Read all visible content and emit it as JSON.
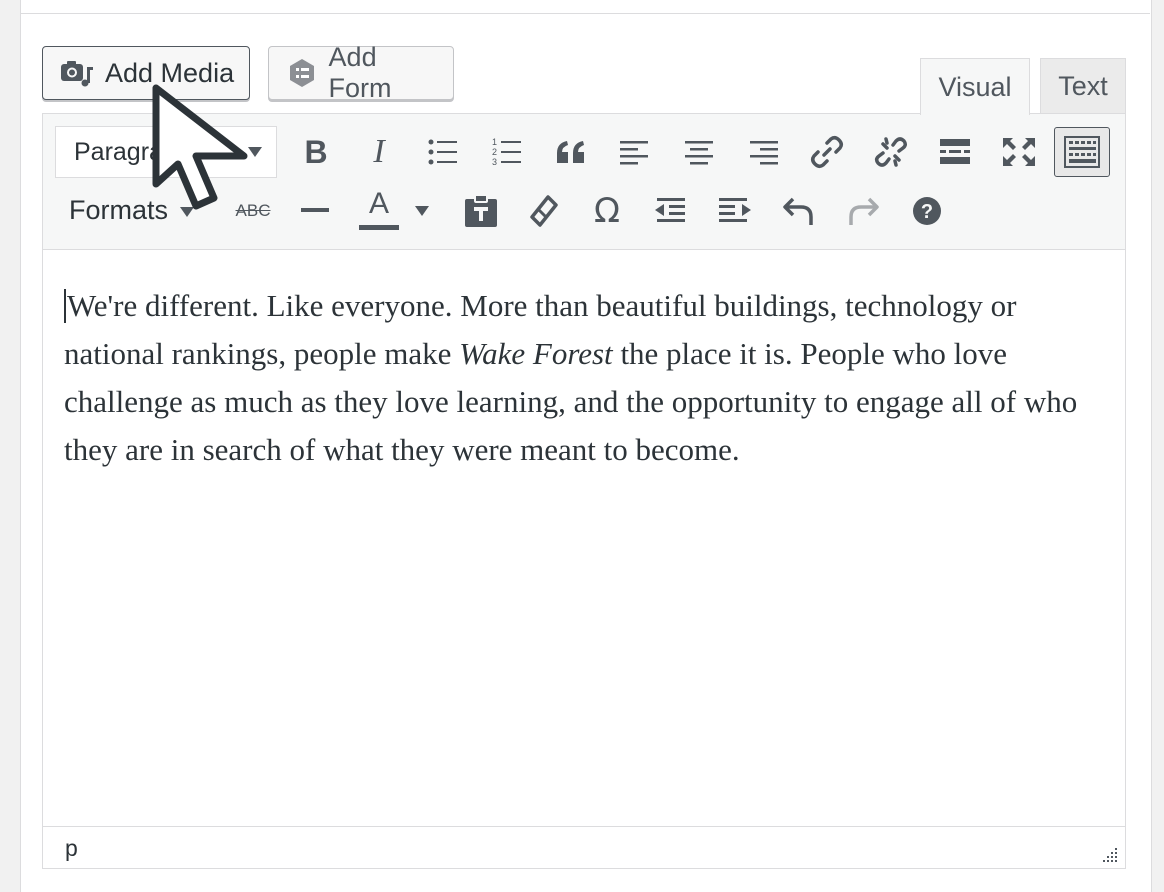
{
  "media_buttons": {
    "add_media": "Add Media",
    "add_form": "Add Form"
  },
  "tabs": {
    "visual": "Visual",
    "text": "Text",
    "active": "Visual"
  },
  "toolbar": {
    "row1": {
      "format_select": "Paragraph",
      "buttons": [
        "bold-icon",
        "italic-icon",
        "bullet-list-icon",
        "numbered-list-icon",
        "blockquote-icon",
        "align-left-icon",
        "align-center-icon",
        "align-right-icon",
        "link-icon",
        "unlink-icon",
        "read-more-icon",
        "fullscreen-icon",
        "toolbar-toggle-icon"
      ]
    },
    "row2": {
      "formats_label": "Formats",
      "strike_label": "ABC",
      "text_color_label": "A",
      "buttons": [
        "strikethrough-icon",
        "horizontal-line-icon",
        "text-color-icon",
        "paste-as-text-icon",
        "clear-formatting-icon",
        "special-character-icon",
        "outdent-icon",
        "indent-icon",
        "undo-icon",
        "redo-icon",
        "help-icon"
      ]
    }
  },
  "content": {
    "before_italic": "We're different. Like everyone. More than beautiful buildings, technology or national rankings, people make ",
    "italic": "Wake Forest",
    "after_italic": " the place it is. People who love challenge as much as they love learning, and the opportunity to engage all of who they are in search of what they were meant to become."
  },
  "statusbar": {
    "path": "p"
  },
  "colors": {
    "icon": "#50575e",
    "border": "#dcdcde",
    "toolbar_bg": "#f6f7f7",
    "disabled": "#a7aaad"
  }
}
